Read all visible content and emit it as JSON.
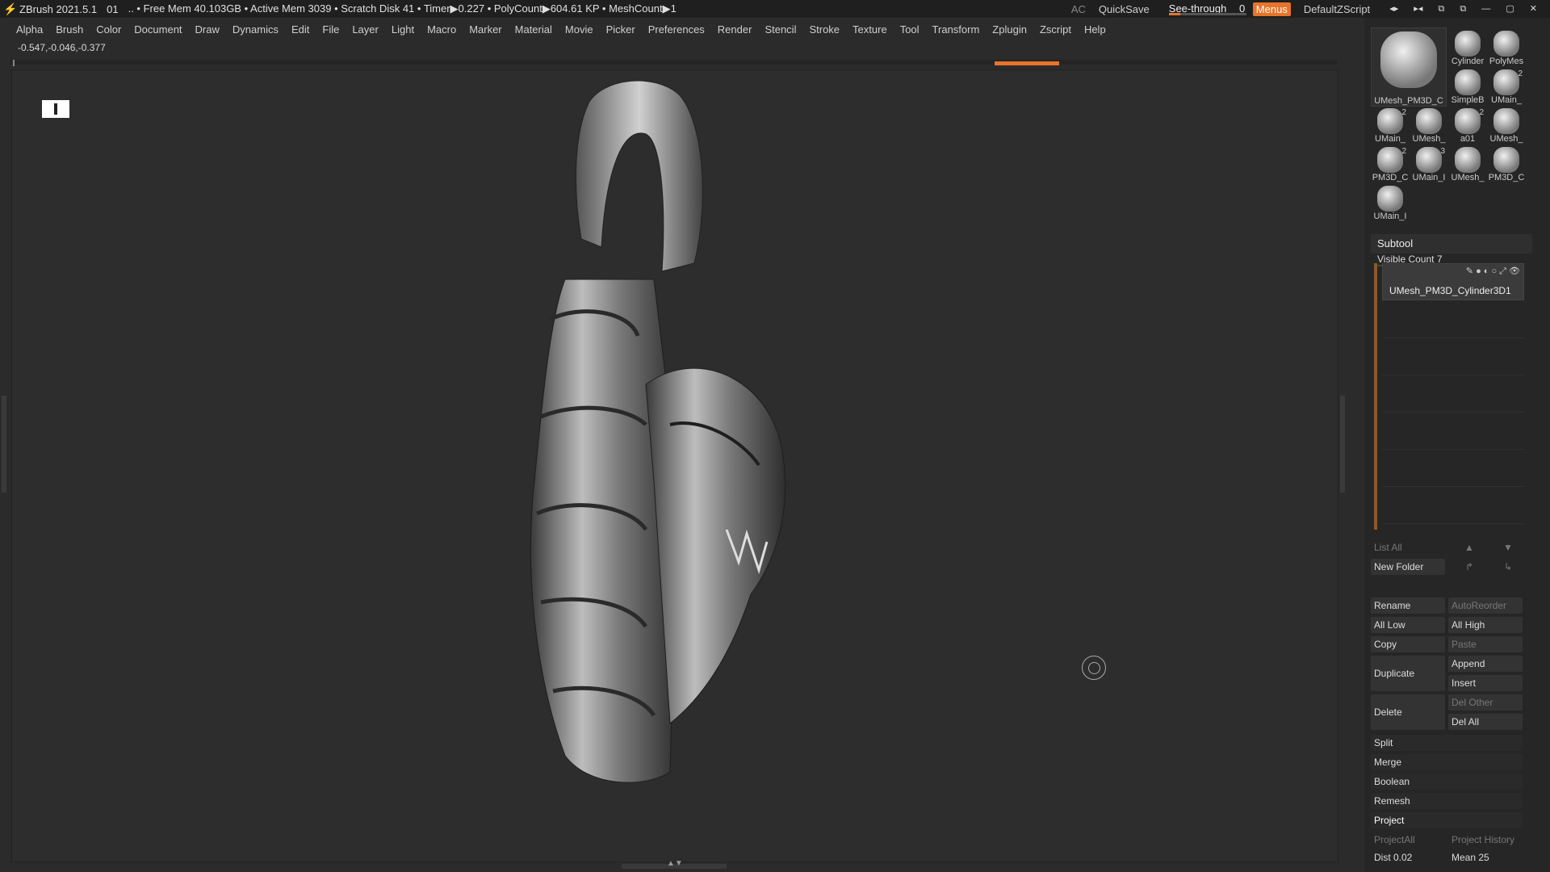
{
  "titlebar": {
    "app": "ZBrush 2021.5.1",
    "doc": "01",
    "stats": ".. • Free Mem 40.103GB • Active Mem 3039 • Scratch Disk 41 •  Timer▶0.227 • PolyCount▶604.61 KP  • MeshCount▶1",
    "ac": "AC",
    "quicksave": "QuickSave",
    "seethrough_label": "See-through",
    "seethrough_value": "0",
    "menus": "Menus",
    "script": "DefaultZScript",
    "win_controls": [
      "◂▸",
      "▸◂",
      "⧉",
      "⧉",
      "—",
      "▢",
      "✕"
    ]
  },
  "menubar": [
    "Alpha",
    "Brush",
    "Color",
    "Document",
    "Draw",
    "Dynamics",
    "Edit",
    "File",
    "Layer",
    "Light",
    "Macro",
    "Marker",
    "Material",
    "Movie",
    "Picker",
    "Preferences",
    "Render",
    "Stencil",
    "Stroke",
    "Texture",
    "Tool",
    "Transform",
    "Zplugin",
    "Zscript",
    "Help"
  ],
  "coords": "-0.547,-0.046,-0.377",
  "tools": [
    {
      "label": "UMesh_PM3D_C",
      "num": ""
    },
    {
      "label": "Cylinder",
      "num": ""
    },
    {
      "label": "PolyMes",
      "num": ""
    },
    {
      "label": "SimpleB",
      "num": ""
    },
    {
      "label": "UMain_",
      "num": "2"
    },
    {
      "label": "UMain_",
      "num": "2"
    },
    {
      "label": "UMesh_",
      "num": ""
    },
    {
      "label": "a01",
      "num": "2"
    },
    {
      "label": "UMesh_",
      "num": ""
    },
    {
      "label": "PM3D_C",
      "num": "2"
    },
    {
      "label": "UMain_I",
      "num": "3"
    },
    {
      "label": "UMesh_",
      "num": ""
    },
    {
      "label": "PM3D_C",
      "num": ""
    },
    {
      "label": "UMain_I",
      "num": ""
    }
  ],
  "subtool": {
    "title": "Subtool",
    "visible_count": "Visible Count 7",
    "item_name": "UMesh_PM3D_Cylinder3D1",
    "list_all": "List All",
    "new_folder": "New Folder",
    "rename": "Rename",
    "autoreorder": "AutoReorder",
    "all_low": "All Low",
    "all_high": "All High",
    "copy": "Copy",
    "paste": "Paste",
    "duplicate": "Duplicate",
    "append": "Append",
    "insert": "Insert",
    "delete": "Delete",
    "del_other": "Del Other",
    "del_all": "Del All",
    "split": "Split",
    "merge": "Merge",
    "boolean": "Boolean",
    "remesh": "Remesh",
    "project": "Project",
    "project_all": "ProjectAll",
    "project_history": "Project History",
    "dist": "Dist 0.02",
    "mean": "Mean 25"
  }
}
